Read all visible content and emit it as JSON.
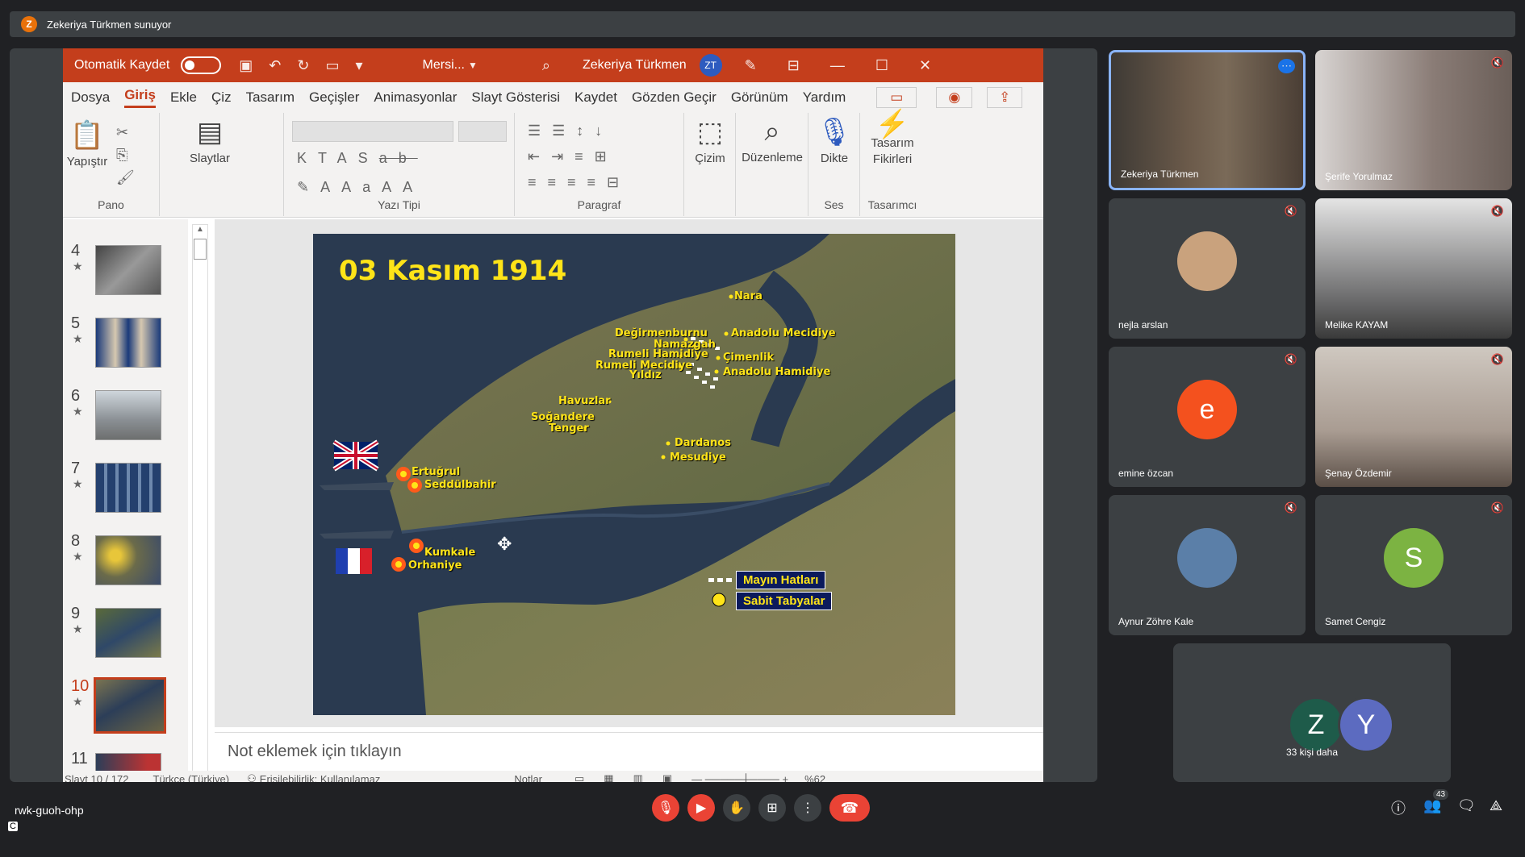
{
  "meet": {
    "presenter_banner": "Zekeriya Türkmen sunuyor",
    "presenter_initial": "Z",
    "meeting_code": "rwk-guoh-ohp",
    "people_count": "43",
    "more_people": "33 kişi daha"
  },
  "ppt": {
    "autosave": "Otomatik Kaydet",
    "file_name": "Mersi...",
    "user_name": "Zekeriya Türkmen",
    "user_initials": "ZT",
    "menu": [
      "Dosya",
      "Giriş",
      "Ekle",
      "Çiz",
      "Tasarım",
      "Geçişler",
      "Animasyonlar",
      "Slayt Gösterisi",
      "Kaydet",
      "Gözden Geçir",
      "Görünüm",
      "Yardım"
    ],
    "ribbon": {
      "paste": "Yapıştır",
      "clipboard": "Pano",
      "slides": "Slaytlar",
      "font": "Yazı Tipi",
      "paragraph": "Paragraf",
      "draw": "Çizim",
      "editing": "Düzenleme",
      "dictate": "Dikte",
      "voice": "Ses",
      "design_ideas_1": "Tasarım",
      "design_ideas_2": "Fikirleri",
      "designer": "Tasarımcı"
    },
    "thumbnails": [
      {
        "num": "4"
      },
      {
        "num": "5"
      },
      {
        "num": "6"
      },
      {
        "num": "7"
      },
      {
        "num": "8"
      },
      {
        "num": "9"
      },
      {
        "num": "10"
      },
      {
        "num": "11"
      }
    ],
    "selected_slide": "10",
    "notes_placeholder": "Not eklemek için tıklayın",
    "status": {
      "slide_pos": "Slayt 10 / 172",
      "language": "Türkçe (Türkiye)",
      "accessibility": "Erişilebilirlik: Kullanılamaz",
      "notes": "Notlar",
      "zoom": "%62"
    }
  },
  "slide": {
    "title": "03 Kasım 1914",
    "places": {
      "nara": "Nara",
      "anadolu_mecidiye": "Anadolu Mecidiye",
      "degirmenburnu": "Değirmenburnu",
      "namazgah": "Namazgah",
      "cimenlik": "Çimenlik",
      "rumeli_hamidiye": "Rumeli Hamidiye",
      "rumeli_mecidiye": "Rumeli Mecidiye",
      "anadolu_hamidiye": "Anadolu Hamidiye",
      "yildiz": "Yıldız",
      "havuzlar": "Havuzlar",
      "sogandere": "Soğandere",
      "tenger": "Tenger",
      "dardanos": "Dardanos",
      "mesudiye": "Mesudiye",
      "ertugrul": "Ertuğrul",
      "seddulbahir": "Seddülbahir",
      "kumkale": "Kumkale",
      "orhaniye": "Orhaniye"
    },
    "legend_mines": "Mayın Hatları",
    "legend_forts": "Sabit Tabyalar"
  },
  "participants": [
    {
      "name": "Zekeriya Türkmen",
      "initial": "",
      "color": "#6b5a4a",
      "muted": false
    },
    {
      "name": "Şerife Yorulmaz",
      "initial": "",
      "color": "#8a7c76",
      "muted": true
    },
    {
      "name": "nejla arslan",
      "initial": "",
      "color": "#c9a27d",
      "muted": true
    },
    {
      "name": "Melike KAYAM",
      "initial": "",
      "color": "#6f6f70",
      "muted": true
    },
    {
      "name": "emine özcan",
      "initial": "e",
      "color": "#f4511e",
      "muted": true
    },
    {
      "name": "Şenay Özdemir",
      "initial": "",
      "color": "#a99c92",
      "muted": true
    },
    {
      "name": "Aynur Zöhre Kale",
      "initial": "",
      "color": "#5b7fa8",
      "muted": true
    },
    {
      "name": "Samet Cengiz",
      "initial": "S",
      "color": "#7cb342",
      "muted": true
    }
  ],
  "others": [
    {
      "initial": "Z",
      "color": "#1e5b4a"
    },
    {
      "initial": "Y",
      "color": "#5c6bc0"
    }
  ],
  "colors": {
    "ppt_accent": "#c43e1c",
    "meet_bg": "#202124",
    "end_call": "#ea4335",
    "slide_text": "#ffe418"
  },
  "icons": {
    "mic": "mic-off-icon",
    "cam": "camera-off-icon",
    "hand": "raise-hand-icon",
    "present": "present-icon",
    "more": "more-vert-icon",
    "end": "end-call-icon",
    "info": "info-icon",
    "people": "people-icon",
    "chat": "chat-icon",
    "activities": "activities-icon"
  }
}
